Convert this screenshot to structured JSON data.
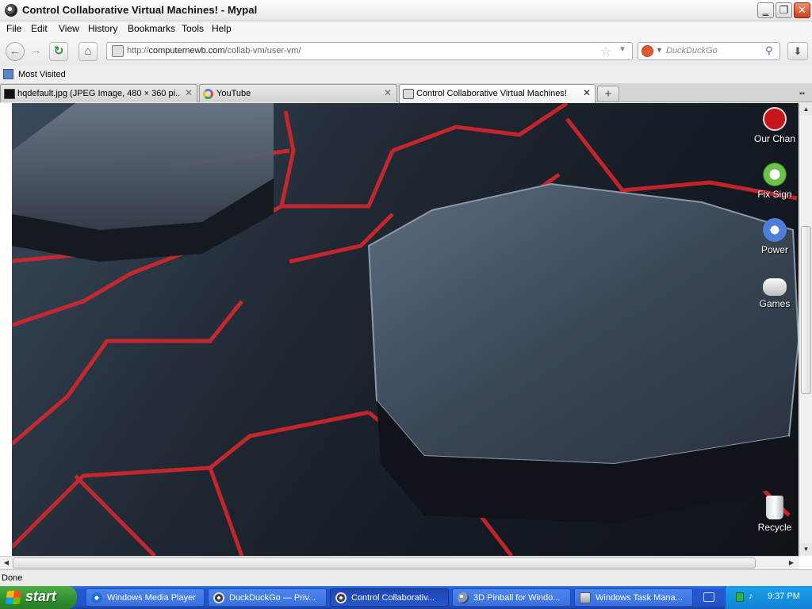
{
  "window": {
    "title": "Control Collaborative Virtual Machines! - Mypal",
    "min_glyph": "‗",
    "max_glyph": "❐",
    "close_glyph": "✕"
  },
  "menu": [
    "File",
    "Edit",
    "View",
    "History",
    "Bookmarks",
    "Tools",
    "Help"
  ],
  "nav": {
    "back_glyph": "←",
    "forward_glyph": "→",
    "reload_glyph": "↻",
    "home_glyph": "⌂",
    "url_prefix": "http://",
    "url_domain": "computernewb.com",
    "url_path": "/collab-vm/user-vm/",
    "search_placeholder": "DuckDuckGo",
    "download_glyph": "⬇"
  },
  "bookmarks": {
    "most_visited": "Most Visited"
  },
  "tabs": [
    {
      "label": "hqdefault.jpg (JPEG Image, 480 × 360 pi...",
      "favicon": "image-thumbnail-icon",
      "active": false
    },
    {
      "label": "YouTube",
      "favicon": "google-icon",
      "active": false
    },
    {
      "label": "Control Collaborative Virtual Machines!",
      "favicon": "collabvm-icon",
      "active": true
    }
  ],
  "vm_desktop": {
    "icons": [
      {
        "label": "Our Chan",
        "icon": "youtube-icon"
      },
      {
        "label": "Fix Sign",
        "icon": "xbox-icon"
      },
      {
        "label": "Power",
        "icon": "power-settings-icon"
      },
      {
        "label": "Games",
        "icon": "gamepad-icon"
      },
      {
        "label": "Recycle",
        "icon": "recycle-bin-icon"
      }
    ]
  },
  "status": {
    "text": "Done"
  },
  "taskbar": {
    "start_label": "start",
    "tasks": [
      {
        "label": "Windows Media Player",
        "icon": "media-player-icon",
        "active": false
      },
      {
        "label": "DuckDuckGo — Priv...",
        "icon": "mypal-icon",
        "active": false
      },
      {
        "label": "Control Collaborativ...",
        "icon": "mypal-icon",
        "active": true
      },
      {
        "label": "3D Pinball for Windo...",
        "icon": "pinball-icon",
        "active": false
      },
      {
        "label": "Windows Task Mana...",
        "icon": "task-manager-icon",
        "active": false
      }
    ],
    "clock": "9:37 PM"
  },
  "colors": {
    "taskbar_blue": "#2457d3",
    "start_green": "#3a9a36",
    "neon_red": "#e0262b",
    "close_red": "#d1502e"
  }
}
